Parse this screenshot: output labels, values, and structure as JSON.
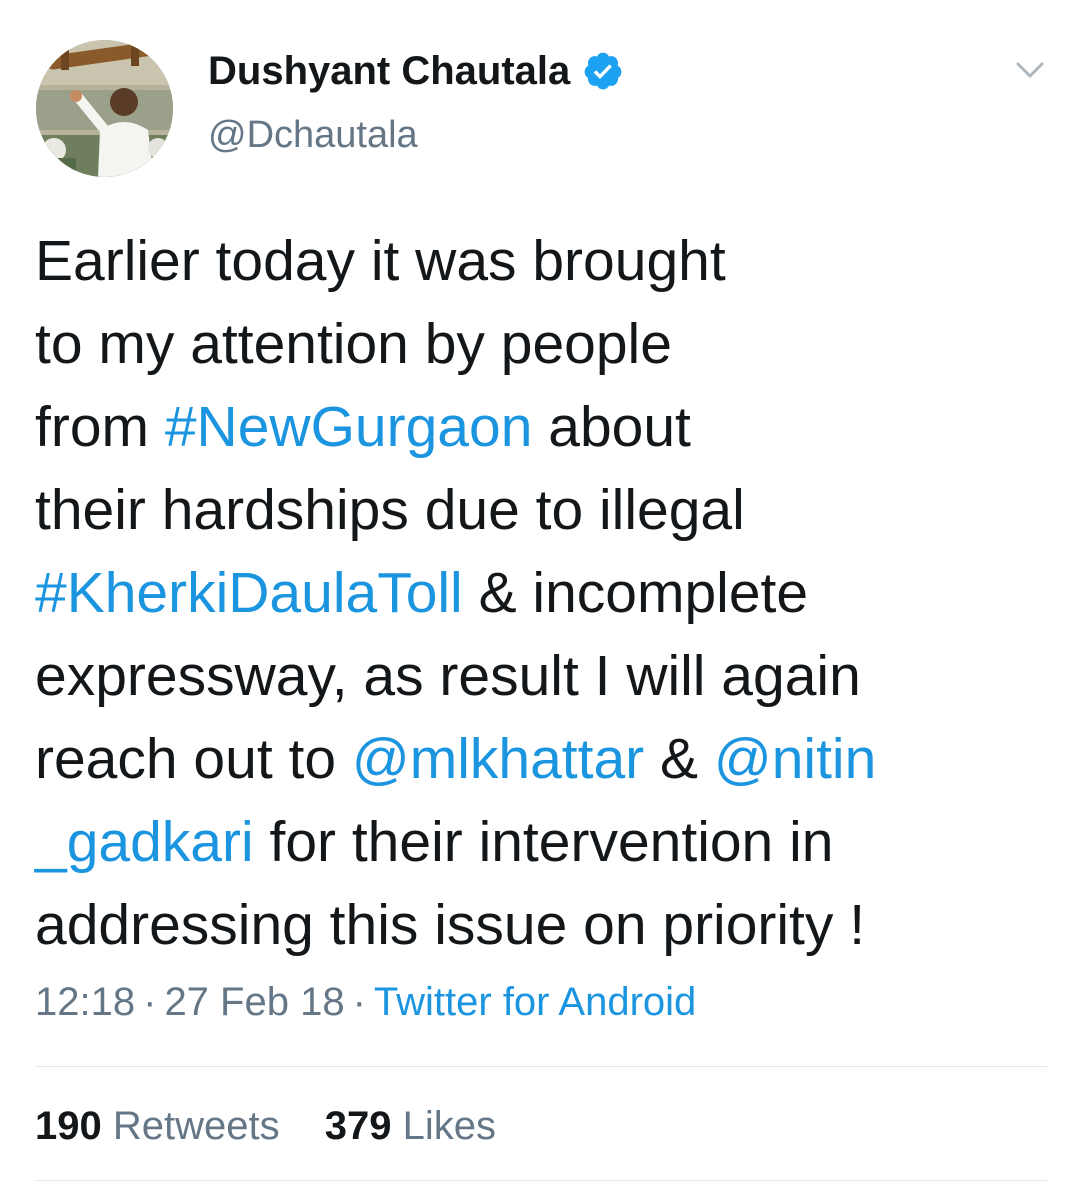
{
  "user": {
    "display_name": "Dushyant Chautala",
    "handle": "@Dchautala",
    "verified_icon": "verified-badge-icon",
    "verified_color": "#1da1f2"
  },
  "tweet": {
    "lines": [
      [
        {
          "text": "Earlier today it was brought"
        }
      ],
      [
        {
          "text": "to my attention by people"
        }
      ],
      [
        {
          "text": "from "
        },
        {
          "text": "#NewGurgaon",
          "link": true
        },
        {
          "text": " about"
        }
      ],
      [
        {
          "text": "their hardships due to illegal"
        }
      ],
      [
        {
          "text": "#KherkiDaulaToll",
          "link": true
        },
        {
          "text": " & incomplete"
        }
      ],
      [
        {
          "text": "expressway, as result I will again"
        }
      ],
      [
        {
          "text": "reach out to "
        },
        {
          "text": "@mlkhattar",
          "link": true
        },
        {
          "text": " & "
        },
        {
          "text": "@nitin",
          "link": true
        }
      ],
      [
        {
          "text": "_gadkari",
          "link": true
        },
        {
          "text": " for their intervention in"
        }
      ],
      [
        {
          "text": "addressing this issue on priority !"
        }
      ]
    ]
  },
  "meta": {
    "time": "12:18",
    "separator": "·",
    "date": "27 Feb 18",
    "source": "Twitter for Android"
  },
  "stats": {
    "retweets_count": "190",
    "retweets_label": "Retweets",
    "likes_count": "379",
    "likes_label": "Likes"
  },
  "colors": {
    "link": "#1b95e0",
    "secondary_text": "#657786",
    "primary_text": "#14171a"
  }
}
